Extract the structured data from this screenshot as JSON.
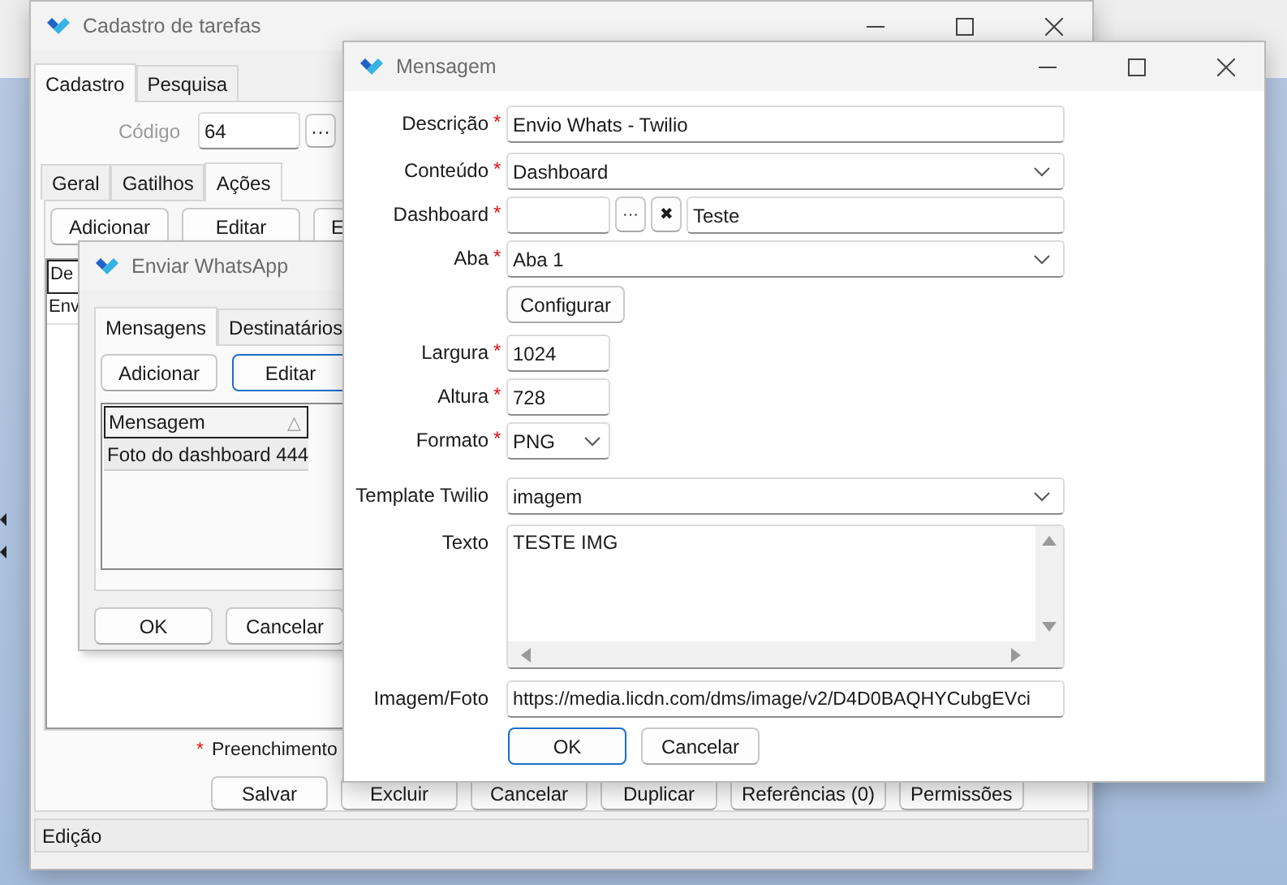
{
  "main_window": {
    "title": "Cadastro de tarefas",
    "tabs": [
      {
        "label": "Cadastro",
        "selected": true
      },
      {
        "label": "Pesquisa",
        "selected": false
      }
    ],
    "code_field": {
      "label": "Código",
      "value": "64",
      "disabled": true,
      "browse_button": "···"
    },
    "subtabs": [
      {
        "label": "Geral",
        "selected": false
      },
      {
        "label": "Gatilhos",
        "selected": false
      },
      {
        "label": "Ações",
        "selected": true
      }
    ],
    "action_buttons": [
      "Adicionar",
      "Editar",
      "E"
    ],
    "grid": {
      "column_1": "De",
      "rows": [
        "Env"
      ]
    },
    "required_note": {
      "mark": "*",
      "text": "Preenchimento"
    },
    "buttons": [
      "Salvar",
      "Excluir",
      "Cancelar",
      "Duplicar",
      "Referências (0)",
      "Permissões"
    ],
    "status_bar": "Edição"
  },
  "whatsapp_window": {
    "title": "Enviar WhatsApp",
    "tabs": [
      {
        "label": "Mensagens",
        "selected": true
      },
      {
        "label": "Destinatários",
        "selected": false
      }
    ],
    "buttons": [
      {
        "label": "Adicionar",
        "focused": false
      },
      {
        "label": "Editar",
        "focused": true
      }
    ],
    "list": {
      "column": {
        "label": "Mensagem",
        "sort_indicator": "△"
      },
      "rows": [
        "Foto do dashboard 444"
      ]
    },
    "footer_buttons": [
      "OK",
      "Cancelar"
    ]
  },
  "message_window": {
    "title": "Mensagem",
    "required_mark": "*",
    "fields": [
      {
        "kind": "text",
        "label": "Descrição",
        "required": true,
        "value": "Envio Whats - Twilio"
      },
      {
        "kind": "select",
        "label": "Conteúdo",
        "required": true,
        "value": "Dashboard"
      },
      {
        "kind": "lookup",
        "label": "Dashboard",
        "required": true,
        "browse_button": "···",
        "clear_button": "✖",
        "value": "Teste"
      },
      {
        "kind": "select",
        "label": "Aba",
        "required": true,
        "value": "Aba 1"
      },
      {
        "kind": "button",
        "label": "Configurar"
      },
      {
        "kind": "short_text",
        "label": "Largura",
        "required": true,
        "value": "1024"
      },
      {
        "kind": "short_text",
        "label": "Altura",
        "required": true,
        "value": "728"
      },
      {
        "kind": "short_select",
        "label": "Formato",
        "required": true,
        "value": "PNG"
      },
      {
        "kind": "select",
        "label": "Template Twilio",
        "required": false,
        "value": "imagem"
      },
      {
        "kind": "textarea",
        "label": "Texto",
        "required": false,
        "value": "TESTE IMG"
      },
      {
        "kind": "text",
        "label": "Imagem/Foto",
        "required": false,
        "value": "https://media.licdn.com/dms/image/v2/D4D0BAQHYCubgEVci"
      }
    ],
    "buttons": [
      {
        "label": "OK",
        "focused": true
      },
      {
        "label": "Cancelar",
        "focused": false
      }
    ]
  }
}
